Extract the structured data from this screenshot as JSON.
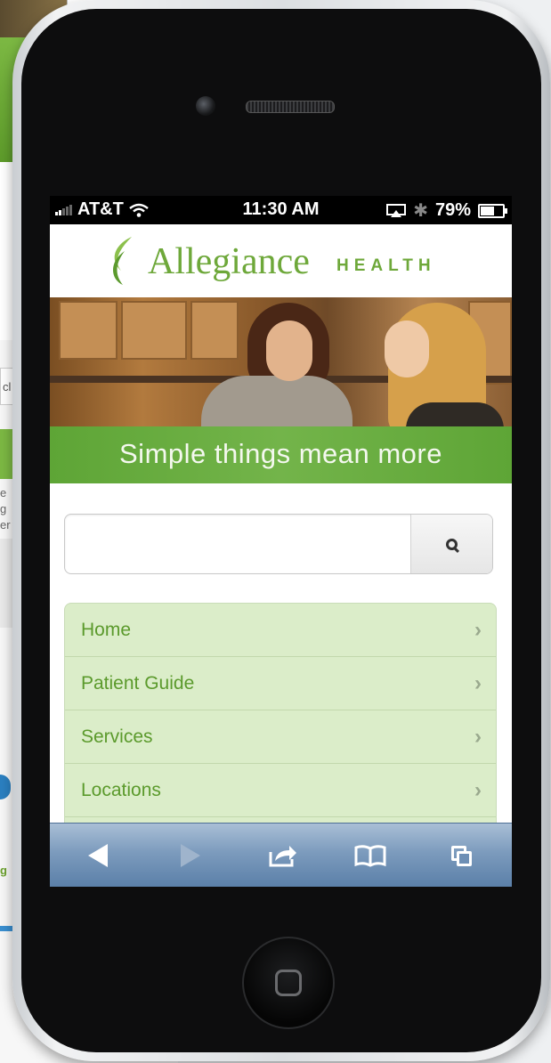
{
  "background_page": {
    "search_fragment": "cl",
    "text_fragments": [
      "e",
      "g",
      "er"
    ],
    "link_fragment": "g"
  },
  "status_bar": {
    "carrier": "AT&T",
    "time": "11:30 AM",
    "battery": "79%",
    "wifi_icon": "wifi-icon",
    "bluetooth_icon": "bluetooth-icon"
  },
  "site": {
    "brand": "Allegiance",
    "brand_suffix": "HEALTH",
    "tagline": "Simple things mean more",
    "brand_color": "#6ea83a",
    "accent_green": "#5ea536",
    "hero_image": "two-women-in-kitchen-photo"
  },
  "search": {
    "placeholder": "",
    "value": "",
    "button_icon": "search-icon"
  },
  "nav": {
    "items": [
      {
        "label": "Home"
      },
      {
        "label": "Patient Guide"
      },
      {
        "label": "Services"
      },
      {
        "label": "Locations"
      },
      {
        "label": ""
      }
    ]
  },
  "toolbar": {
    "back_icon": "back-arrow-icon",
    "forward_icon": "forward-arrow-icon",
    "share_icon": "share-icon",
    "bookmarks_icon": "bookmarks-icon",
    "tabs_icon": "tabs-icon"
  }
}
